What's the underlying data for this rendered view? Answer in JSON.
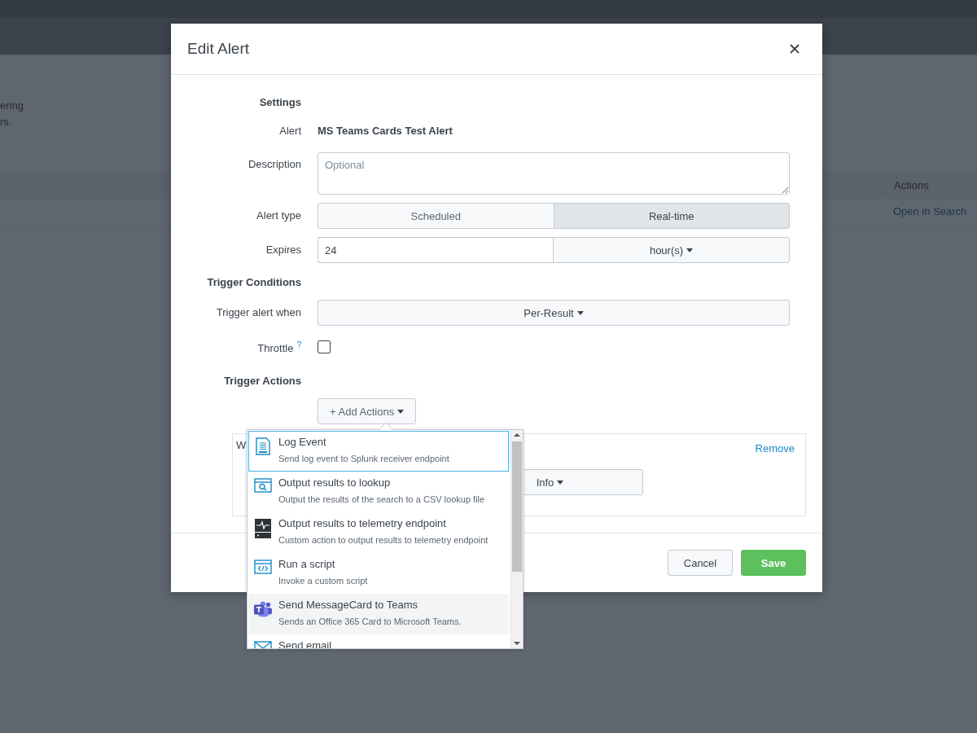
{
  "background": {
    "text_lines": [
      "ering",
      "rs."
    ],
    "table": {
      "columns": [
        "Actions"
      ],
      "rows": [
        [
          "Open in Search"
        ]
      ]
    }
  },
  "dialog": {
    "title": "Edit Alert",
    "settings_heading": "Settings",
    "alert": {
      "label": "Alert",
      "value": "MS Teams Cards Test Alert"
    },
    "description": {
      "label": "Description",
      "placeholder": "Optional"
    },
    "alert_type": {
      "label": "Alert type",
      "options": [
        {
          "label": "Scheduled",
          "selected": false
        },
        {
          "label": "Real-time",
          "selected": true
        }
      ]
    },
    "expires": {
      "label": "Expires",
      "value": "24",
      "unit": "hour(s)"
    },
    "trigger_conditions_heading": "Trigger Conditions",
    "trigger_alert_when": {
      "label": "Trigger alert when",
      "value": "Per-Result"
    },
    "throttle": {
      "label": "Throttle",
      "help": "?",
      "checked": false
    },
    "trigger_actions_heading": "Trigger Actions",
    "add_actions": "+ Add Actions",
    "action_card": {
      "label": "W",
      "remove": "Remove",
      "severity": "Info"
    },
    "actions_menu": [
      {
        "kind": "log",
        "title": "Log Event",
        "description": "Send log event to Splunk receiver endpoint",
        "selected": true,
        "hovered": false
      },
      {
        "kind": "lookup",
        "title": "Output results to lookup",
        "description": "Output the results of the search to a CSV lookup file",
        "selected": false,
        "hovered": false
      },
      {
        "kind": "telemetry",
        "title": "Output results to telemetry endpoint",
        "description": "Custom action to output results to telemetry endpoint",
        "selected": false,
        "hovered": false
      },
      {
        "kind": "script",
        "title": "Run a script",
        "description": "Invoke a custom script",
        "selected": false,
        "hovered": false
      },
      {
        "kind": "teams",
        "title": "Send MessageCard to Teams",
        "description": "Sends an Office 365 Card to Microsoft Teams.",
        "selected": false,
        "hovered": true
      },
      {
        "kind": "email",
        "title": "Send email",
        "selected": false,
        "hovered": false
      }
    ],
    "buttons": {
      "cancel": "Cancel",
      "save": "Save"
    }
  }
}
